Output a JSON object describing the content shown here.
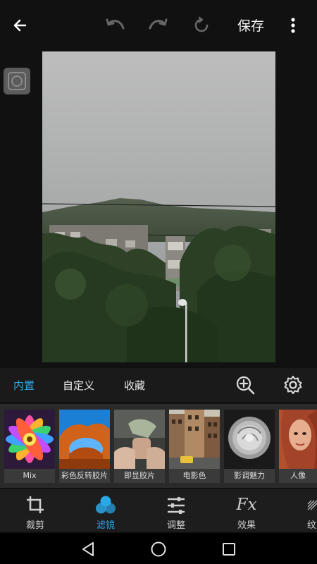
{
  "topbar": {
    "back_icon": "arrow-left-icon",
    "undo_icon": "undo-icon",
    "redo_icon": "redo-icon",
    "reset_icon": "reset-icon",
    "save_label": "保存",
    "more_icon": "more-vertical-icon"
  },
  "compare_icon": "compare-icon",
  "tabs": {
    "items": [
      {
        "label": "内置",
        "active": true
      },
      {
        "label": "自定义",
        "active": false
      },
      {
        "label": "收藏",
        "active": false
      }
    ],
    "zoom_icon": "zoom-in-icon",
    "settings_icon": "gear-icon"
  },
  "filters": [
    {
      "label": "Mix"
    },
    {
      "label": "彩色反转胶片"
    },
    {
      "label": "即显胶片"
    },
    {
      "label": "电影色"
    },
    {
      "label": "影调魅力"
    },
    {
      "label": "人像"
    }
  ],
  "toolbar": {
    "items": [
      {
        "label": "裁剪",
        "icon": "crop-icon",
        "active": false
      },
      {
        "label": "滤镜",
        "icon": "filters-icon",
        "active": true
      },
      {
        "label": "调整",
        "icon": "sliders-icon",
        "active": false
      },
      {
        "label": "效果",
        "icon": "fx-icon",
        "active": false
      },
      {
        "label": "纹",
        "icon": "texture-icon",
        "active": false
      }
    ]
  },
  "navbar": {
    "back_icon": "nav-back-icon",
    "home_icon": "nav-home-icon",
    "recents_icon": "nav-recents-icon"
  },
  "colors": {
    "accent": "#2aa8e8",
    "background": "#111111"
  }
}
